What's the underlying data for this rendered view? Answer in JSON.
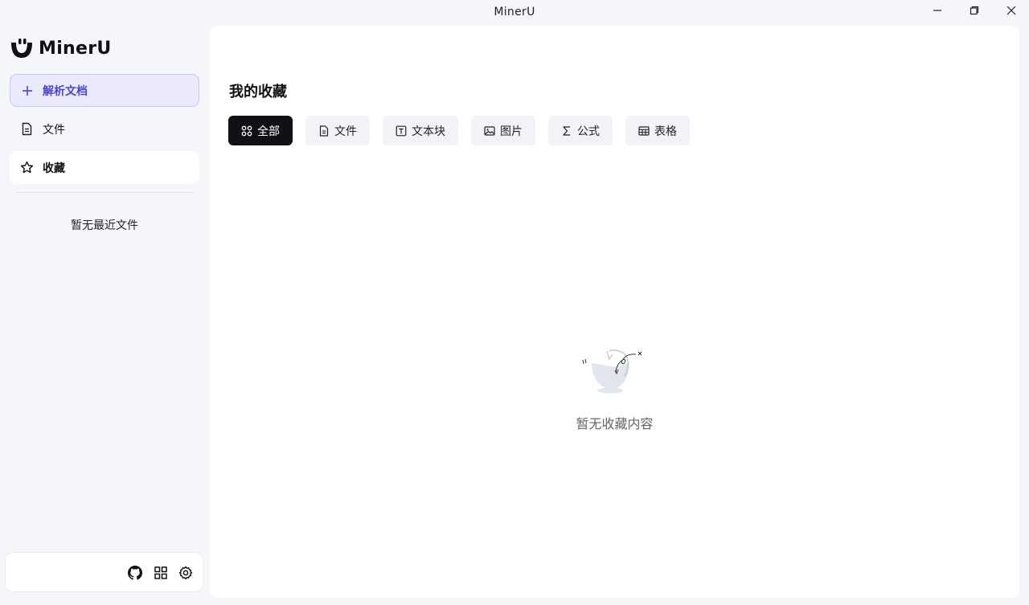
{
  "window": {
    "title": "MinerU",
    "controls": [
      "minimize-icon",
      "restore-icon",
      "close-icon"
    ]
  },
  "sidebar": {
    "brand": "MinerU",
    "new_button": {
      "label": "解析文档",
      "icon": "plus-icon",
      "accent": "#4b45d6"
    },
    "items": [
      {
        "label": "文件",
        "icon": "file-icon",
        "active": false
      },
      {
        "label": "收藏",
        "icon": "star-icon",
        "active": true
      }
    ],
    "recent_empty": "暂无最近文件",
    "footer_icons": [
      "github-icon",
      "apps-grid-icon",
      "settings-icon"
    ]
  },
  "main": {
    "title": "我的收藏",
    "tabs": [
      {
        "label": "全部",
        "icon": "grid-dots-icon",
        "active": true
      },
      {
        "label": "文件",
        "icon": "file-icon",
        "active": false
      },
      {
        "label": "文本块",
        "icon": "text-block-icon",
        "active": false
      },
      {
        "label": "图片",
        "icon": "image-icon",
        "active": false
      },
      {
        "label": "公式",
        "icon": "sigma-icon",
        "active": false
      },
      {
        "label": "表格",
        "icon": "table-icon",
        "active": false
      }
    ],
    "empty_text": "暂无收藏内容"
  },
  "colors": {
    "background": "#f5f6fa",
    "active_tab": "#0f1115",
    "accent": "#4b45d6"
  }
}
